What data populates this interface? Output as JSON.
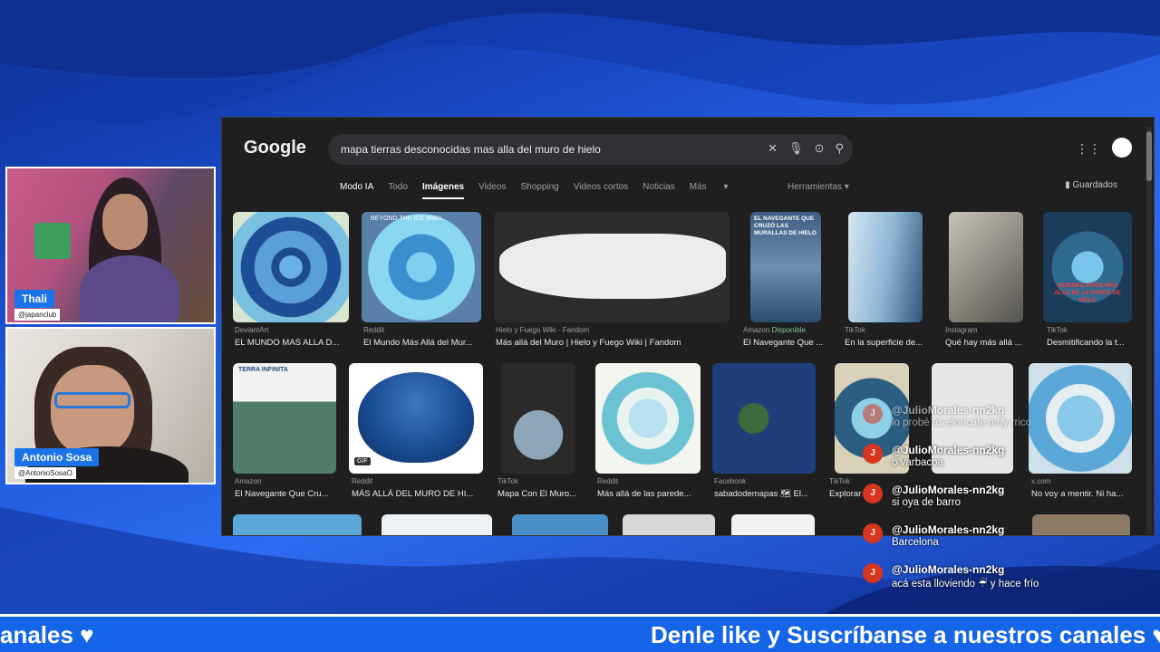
{
  "webcams": [
    {
      "name": "Thali",
      "handle": "@japanclub"
    },
    {
      "name": "Antonio Sosa",
      "handle": "@AntonioSosaO"
    }
  ],
  "browser": {
    "logo": "Google",
    "search_query": "mapa tierras desconocidas mas alla del muro de hielo",
    "tabs": [
      "Modo IA",
      "Todo",
      "Imágenes",
      "Videos",
      "Shopping",
      "Videos cortos",
      "Noticias",
      "Más"
    ],
    "tools": "Herramientas",
    "saved": "Guardados",
    "row1": [
      {
        "source": "DeviantArt",
        "caption": "EL MUNDO MAS ALLA D..."
      },
      {
        "source": "Reddit",
        "caption": "El Mundo Más Allá del Mur..."
      },
      {
        "source": "Hielo y Fuego Wiki · Fandom",
        "caption": "Más allá del Muro | Hielo y Fuego Wiki | Fandom"
      },
      {
        "source": "Amazon",
        "source_extra": "Disponible",
        "caption": "El Navegante Que ..."
      },
      {
        "source": "TikTok",
        "caption": "En la superficie de..."
      },
      {
        "source": "Instagram",
        "caption": "Qué hay más allá ..."
      },
      {
        "source": "TikTok",
        "caption": "Desmitificando la t..."
      }
    ],
    "row2": [
      {
        "source": "Amazon",
        "caption": "El Navegante Que Cru..."
      },
      {
        "source": "Reddit",
        "caption": "MÁS ALLÁ DEL MURO DE HI..."
      },
      {
        "source": "TikTok",
        "caption": "Mapa Con El Muro..."
      },
      {
        "source": "Reddit",
        "caption": "Más allá de las parede..."
      },
      {
        "source": "Facebook",
        "caption": "sabadodemapas 🗺 El..."
      },
      {
        "source": "TikTok",
        "caption": "Explorar"
      },
      {
        "source": "x.com",
        "caption": "No voy a mentir. Ni ha..."
      }
    ],
    "thumb_texts": {
      "t2": "BEYOND THE ICE WALL",
      "t4": "EL NAVEGANTE QUE CRUZÓ LAS MURALLAS DE HIELO",
      "t7": "QUIENES VIVEN MÁS ALLÁ DE LA PARED DE HIELO",
      "t8": "TERRA INFINITA",
      "b3": "GIF"
    }
  },
  "chat": [
    {
      "user": "@JulioMorales-nn2kg",
      "text": "lo probé as eloncafe muy rrico"
    },
    {
      "user": "@JulioMorales-nn2kg",
      "text": "o varbacoa"
    },
    {
      "user": "@JulioMorales-nn2kg",
      "text": "si oya de barro"
    },
    {
      "user": "@JulioMorales-nn2kg",
      "text": "Barcelona"
    },
    {
      "user": "@JulioMorales-nn2kg",
      "text": "acá esta lloviendo ☔ y hace frío"
    }
  ],
  "ticker": {
    "left": "anales ♥",
    "right": "Denle like y Suscríbanse a nuestros canales ♥"
  },
  "colors": {
    "accent": "#1a73e8",
    "ticker_bg": "#1565e8",
    "avatar": "#d9351d"
  }
}
